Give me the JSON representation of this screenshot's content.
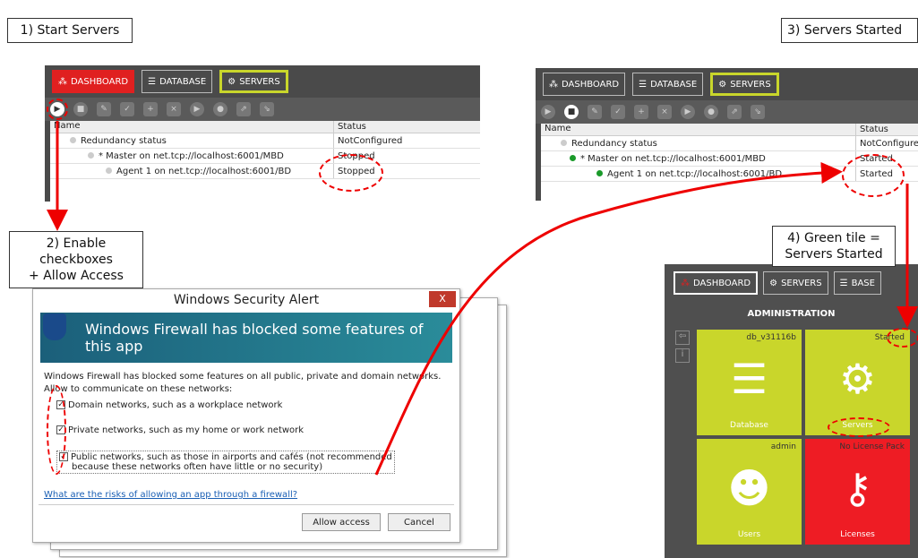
{
  "callouts": {
    "c1": "1) Start Servers",
    "c2_line1": "2) Enable checkboxes",
    "c2_line2": "+ Allow Access",
    "c3": "3) Servers Started",
    "c4_line1": "4) Green tile =",
    "c4_line2": "Servers Started"
  },
  "left_panel": {
    "tabs": {
      "dashboard": "DASHBOARD",
      "database": "DATABASE",
      "servers": "SERVERS"
    },
    "grid": {
      "headers": {
        "name": "Name",
        "status": "Status"
      },
      "rows": [
        {
          "name": "Redundancy status",
          "status": "NotConfigured"
        },
        {
          "name": "* Master on net.tcp://localhost:6001/MBD",
          "status": "Stopped"
        },
        {
          "name": "Agent 1 on net.tcp://localhost:6001/BD",
          "status": "Stopped"
        }
      ]
    }
  },
  "right_panel": {
    "tabs": {
      "dashboard": "DASHBOARD",
      "database": "DATABASE",
      "servers": "SERVERS"
    },
    "grid": {
      "headers": {
        "name": "Name",
        "status": "Status"
      },
      "rows": [
        {
          "name": "Redundancy status",
          "status": "NotConfigured"
        },
        {
          "name": "* Master on net.tcp://localhost:6001/MBD",
          "status": "Started"
        },
        {
          "name": "Agent 1 on net.tcp://localhost:6001/BD",
          "status": "Started"
        }
      ]
    }
  },
  "dialog": {
    "title": "Windows Security Alert",
    "banner": "Windows Firewall has blocked some features of this app",
    "line1": "Windows Firewall has blocked some features on all public, private and domain networks.",
    "line2": "Allow to communicate on these networks:",
    "opt1": "Domain networks, such as a workplace network",
    "opt2": "Private networks, such as my home or work network",
    "opt3a": "Public networks, such as those in airports and cafés (not recommended",
    "opt3b": "because these networks often have little or no security)",
    "link": "What are the risks of allowing an app through a firewall?",
    "allow": "Allow access",
    "cancel": "Cancel",
    "close": "X"
  },
  "dashboard": {
    "tabs": {
      "dashboard": "DASHBOARD",
      "servers": "SERVERS",
      "database": "BASE"
    },
    "title": "ADMINISTRATION",
    "tiles": [
      {
        "top": "db_v31116b",
        "bottom": "Database",
        "color": "#c9d62b"
      },
      {
        "top": "Started",
        "bottom": "Servers",
        "color": "#c9d62b"
      },
      {
        "top": "admin",
        "bottom": "Users",
        "color": "#c9d62b"
      },
      {
        "top": "No License Pack",
        "bottom": "Licenses",
        "color": "#ee1c24"
      }
    ]
  },
  "accent_colors": {
    "red": "#e02020",
    "lime": "#c9d62b",
    "green_dot": "#1a9a2a"
  }
}
